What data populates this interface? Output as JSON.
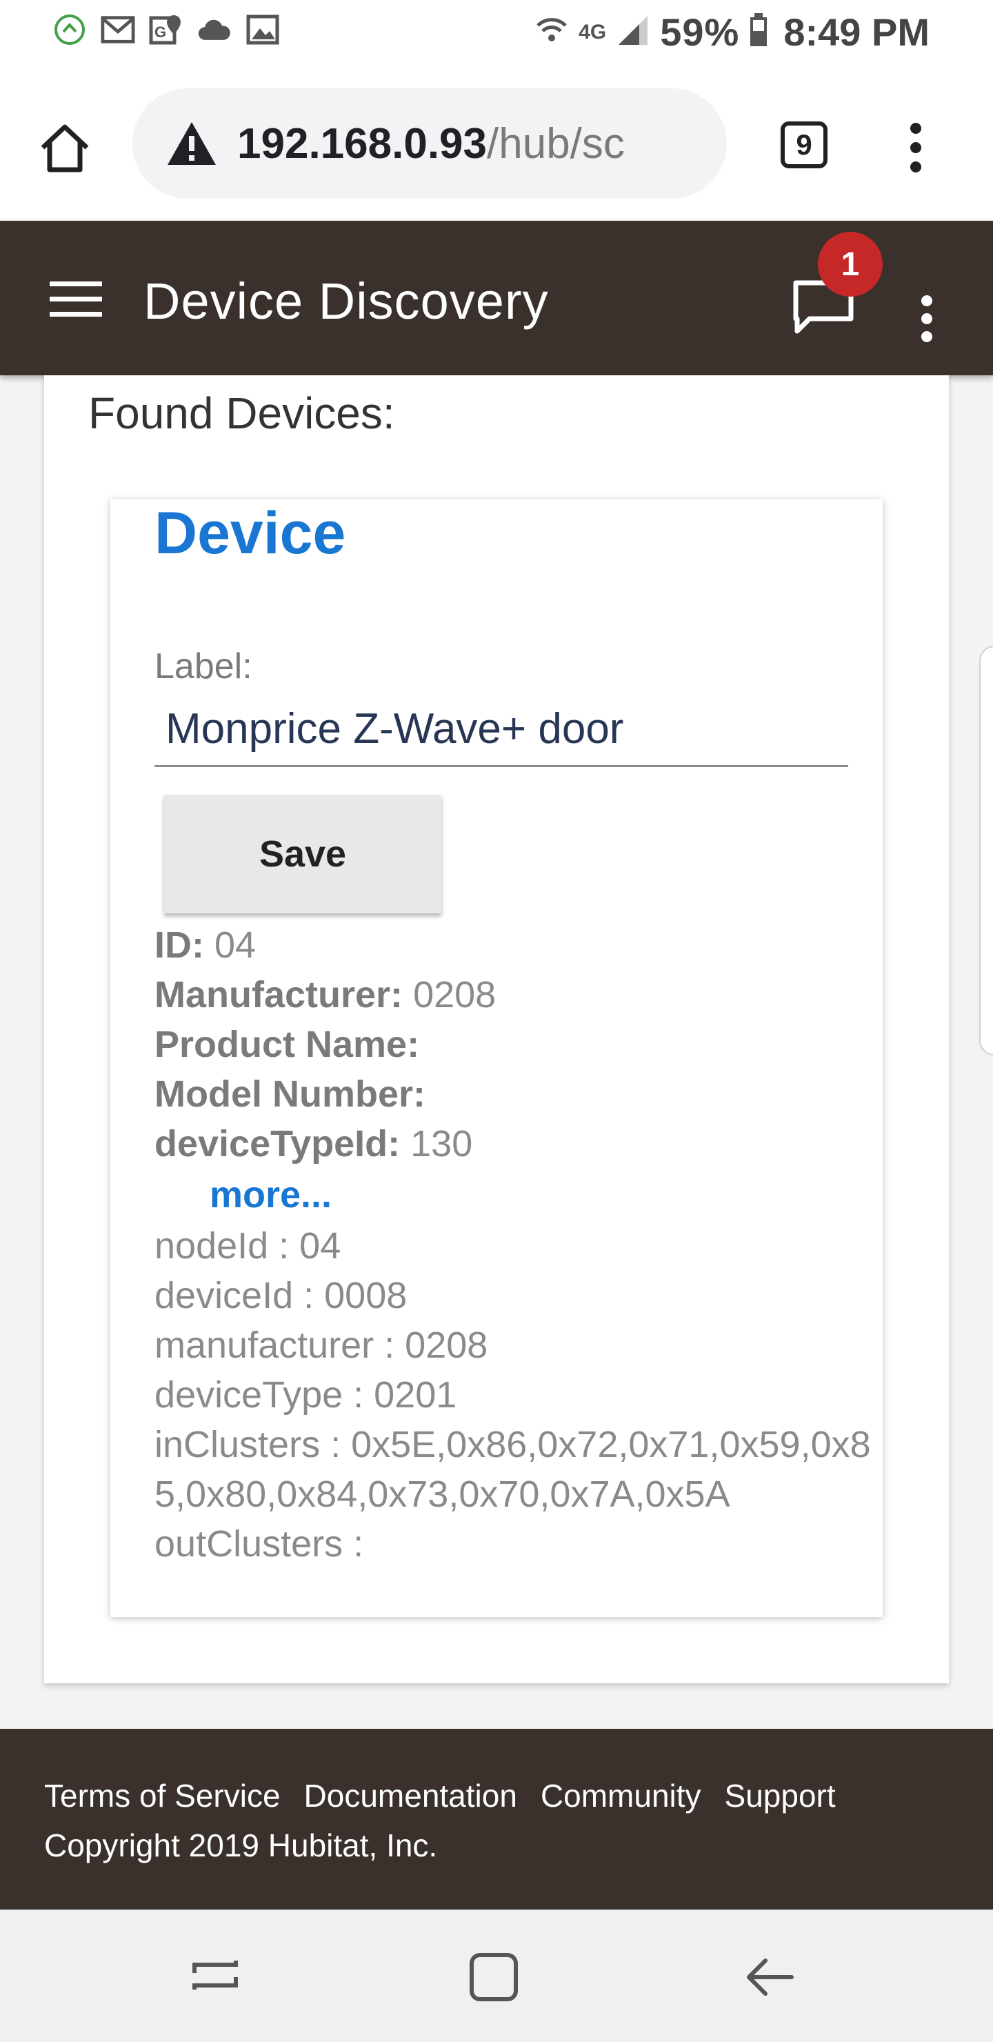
{
  "status_bar": {
    "battery": "59%",
    "time": "8:49 PM",
    "network": "4G",
    "left_icons": [
      "hubitat-icon",
      "gmail-icon",
      "google-maps-icon",
      "cloud-icon",
      "image-icon"
    ],
    "right_icons": [
      "wifi-icon",
      "signal-icon",
      "battery-icon"
    ]
  },
  "browser": {
    "url_host": "192.168.0.93",
    "url_path": "/hub/sc",
    "tab_count": "9"
  },
  "app_header": {
    "title": "Device Discovery",
    "notification_count": "1"
  },
  "main": {
    "found_title": "Found Devices:",
    "device": {
      "title": "Device",
      "label_caption": "Label:",
      "label_value": "Monprice Z-Wave+ door",
      "save_label": "Save",
      "fields": [
        {
          "name": "ID:",
          "value": "04"
        },
        {
          "name": "Manufacturer:",
          "value": "0208"
        },
        {
          "name": "Product Name:",
          "value": ""
        },
        {
          "name": "Model Number:",
          "value": ""
        },
        {
          "name": "deviceTypeId:",
          "value": "130"
        }
      ],
      "more_label": "more...",
      "raw": [
        "nodeId : 04",
        "deviceId : 0008",
        "manufacturer : 0208",
        "deviceType : 0201",
        "inClusters : 0x5E,0x86,0x72,0x71,0x59,0x85,0x80,0x84,0x73,0x70,0x7A,0x5A",
        "outClusters :"
      ]
    }
  },
  "footer": {
    "links": [
      "Terms of Service",
      "Documentation",
      "Community",
      "Support"
    ],
    "copyright": "Copyright 2019 Hubitat, Inc."
  },
  "colors": {
    "header_bg": "#3a302c",
    "accent_blue": "#1976d2",
    "badge_red": "#c62828"
  }
}
